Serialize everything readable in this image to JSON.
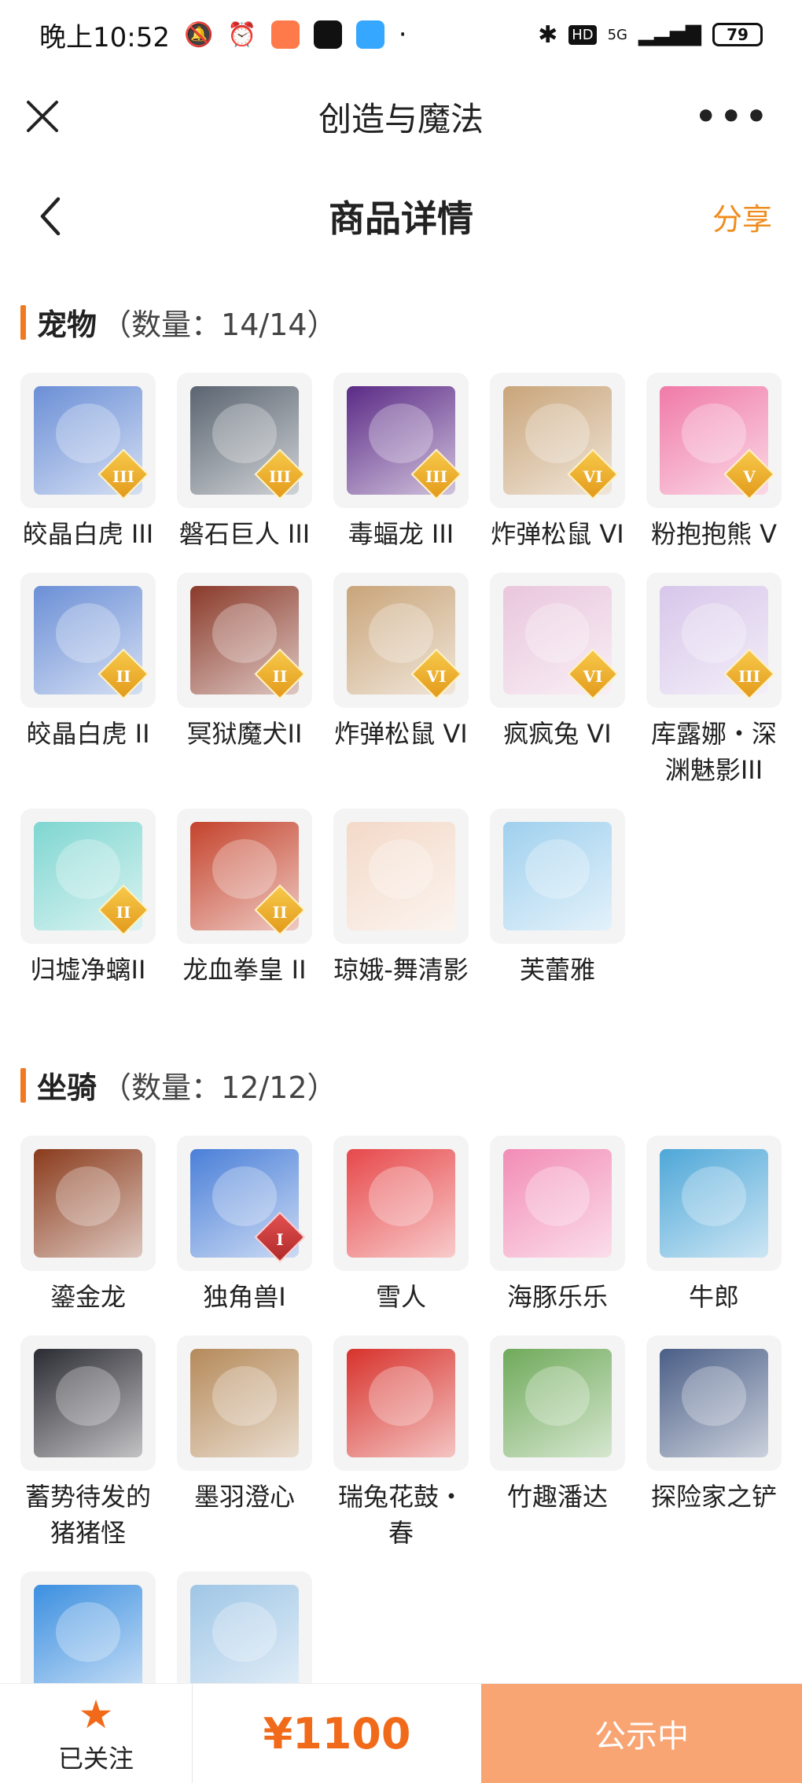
{
  "status_bar": {
    "time": "晚上10:52",
    "network": "5G",
    "battery": "79"
  },
  "app_bar": {
    "title": "创造与魔法"
  },
  "header": {
    "title": "商品详情",
    "share_label": "分享"
  },
  "pets": {
    "title": "宠物",
    "count": "（数量：14/14）",
    "items": [
      {
        "label": "皎晶白虎 III",
        "tier": "III",
        "color": "#6b8fd6",
        "icon": "white-tiger-icon"
      },
      {
        "label": "磐石巨人 III",
        "tier": "III",
        "color": "#5a6470",
        "icon": "rock-giant-icon"
      },
      {
        "label": "毒蝠龙 III",
        "tier": "III",
        "color": "#5b2a86",
        "icon": "poison-bat-dragon-icon"
      },
      {
        "label": "炸弹松鼠 VI",
        "tier": "VI",
        "color": "#c9a57a",
        "icon": "bomb-squirrel-icon"
      },
      {
        "label": "粉抱抱熊 V",
        "tier": "V",
        "color": "#f07aa8",
        "icon": "pink-bear-icon"
      },
      {
        "label": "皎晶白虎 II",
        "tier": "II",
        "color": "#6b8fd6",
        "icon": "white-tiger-icon"
      },
      {
        "label": "冥狱魔犬II",
        "tier": "II",
        "color": "#8a3a2a",
        "icon": "hell-hound-icon"
      },
      {
        "label": "炸弹松鼠 VI",
        "tier": "VI",
        "color": "#c9a57a",
        "icon": "bomb-squirrel-icon"
      },
      {
        "label": "疯疯兔 VI",
        "tier": "VI",
        "color": "#e9c6dd",
        "icon": "crazy-rabbit-icon"
      },
      {
        "label": "库露娜・深渊魅影III",
        "tier": "III",
        "color": "#d7c6ea",
        "icon": "kuluna-icon"
      },
      {
        "label": "归墟净螭II",
        "tier": "II",
        "color": "#7fd6d1",
        "icon": "jade-dragon-icon"
      },
      {
        "label": "龙血拳皇 II",
        "tier": "II",
        "color": "#c4432c",
        "icon": "dragon-boxer-icon"
      },
      {
        "label": "琼娥-舞清影",
        "tier": "",
        "color": "#f3d9c8",
        "icon": "dancer-doll-icon"
      },
      {
        "label": "芙蕾雅",
        "tier": "",
        "color": "#9fd0ee",
        "icon": "freya-icon"
      }
    ]
  },
  "mounts": {
    "title": "坐骑",
    "count": "（数量：12/12）",
    "items": [
      {
        "label": "鎏金龙",
        "tier": "",
        "color": "#8a3b1c",
        "icon": "golden-dragon-icon"
      },
      {
        "label": "独角兽I",
        "tier": "I",
        "color": "#4a7fd8",
        "icon": "unicorn-icon"
      },
      {
        "label": "雪人",
        "tier": "",
        "color": "#e7484a",
        "icon": "snowman-icon"
      },
      {
        "label": "海豚乐乐",
        "tier": "",
        "color": "#f28cb6",
        "icon": "dolphin-icon"
      },
      {
        "label": "牛郎",
        "tier": "",
        "color": "#4ea7d8",
        "icon": "cowherd-icon"
      },
      {
        "label": "蓄势待发的猪猪怪",
        "tier": "",
        "color": "#2b2b33",
        "icon": "pig-monster-icon"
      },
      {
        "label": "墨羽澄心",
        "tier": "",
        "color": "#b58a5a",
        "icon": "feather-sword-icon"
      },
      {
        "label": "瑞兔花鼓・春",
        "tier": "",
        "color": "#d8322c",
        "icon": "rabbit-drum-icon"
      },
      {
        "label": "竹趣潘达",
        "tier": "",
        "color": "#6faa5a",
        "icon": "panda-icon"
      },
      {
        "label": "探险家之铲",
        "tier": "",
        "color": "#4a5e86",
        "icon": "shovel-icon"
      },
      {
        "label": "",
        "tier": "",
        "color": "#3c8fe0",
        "icon": "whale-icon"
      },
      {
        "label": "",
        "tier": "",
        "color": "#9fc6e6",
        "icon": "whale-duck-icon"
      }
    ]
  },
  "bottom_bar": {
    "follow_label": "已关注",
    "price": "¥1100",
    "cta_label": "公示中"
  }
}
